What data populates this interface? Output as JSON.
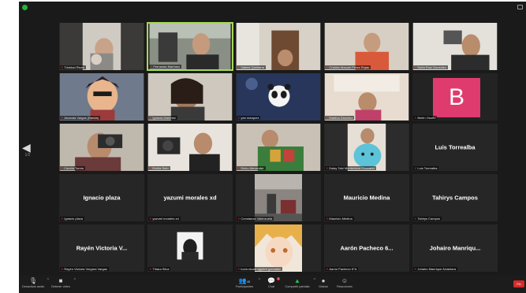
{
  "participants": {
    "row1": [
      {
        "label": "Trinidad Rivas"
      },
      {
        "label": "Fernanda Martínez"
      },
      {
        "label": "Valeria Quintana"
      },
      {
        "label": "Cristián Manuel Pérez Rojas"
      },
      {
        "label": "Sofía Ruiz González"
      }
    ],
    "row2": [
      {
        "label": "Amanda Vargas (Banda)"
      },
      {
        "label": "Ignacia Martínez"
      },
      {
        "label": "yan marquez"
      },
      {
        "label": "Martina Sánchez"
      },
      {
        "label": "Belén Osorio",
        "initial": "B"
      }
    ],
    "row3": [
      {
        "label": "Camila Torres"
      },
      {
        "label": "Emilia Soto"
      },
      {
        "label": "Dinko Alexander"
      },
      {
        "label": "Daisy Tabi Montecinos Gonzalez"
      },
      {
        "label": "Luis Torrealba",
        "name": "Luis Torrealba"
      }
    ],
    "row4": [
      {
        "label": "Ignacio plaza",
        "name": "Ignacio plaza"
      },
      {
        "label": "yazumi morales xd",
        "name": "yazumi morales xd"
      },
      {
        "label": "Constanza Valenzuela"
      },
      {
        "label": "Mauricio Medina",
        "name": "Mauricio Medina"
      },
      {
        "label": "Tahirys Campos",
        "name": "Tahirys Campos"
      }
    ],
    "row5": [
      {
        "label": "Rayén Victoria Vergara Vargas",
        "name": "Rayén Victoria V..."
      },
      {
        "label": "Thiara Silva"
      },
      {
        "label": "lucía nicole aguirre gonzalez"
      },
      {
        "label": "Aarón Pacheco 6°A",
        "name": "Aarón Pacheco 6..."
      },
      {
        "label": "Johairo Manrique Alcántara",
        "name": "Johairo Manriqu..."
      }
    ]
  },
  "toolbar": {
    "audio": "Desactivar audio",
    "video": "Detener video",
    "participants": "Participantes",
    "participants_count": "45",
    "chat": "Chat",
    "chat_badge": "1",
    "share": "Compartir pantalla",
    "record": "Grabar",
    "reactions": "Reacciones",
    "end": "Fin"
  },
  "colors": {
    "active_speaker": "#a6d957",
    "mute": "#e23b3b",
    "share": "#23c552",
    "avatar_b": "#e03b6e"
  }
}
